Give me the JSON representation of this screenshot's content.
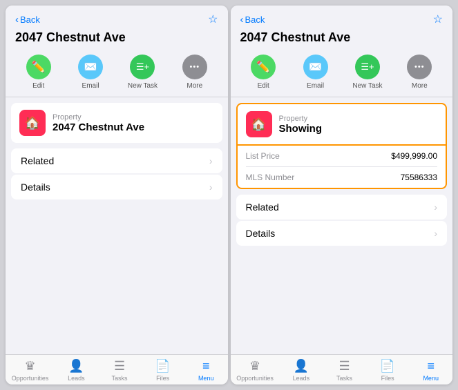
{
  "left_panel": {
    "back_label": "Back",
    "title": "2047 Chestnut Ave",
    "bookmark_icon": "☆",
    "actions": [
      {
        "id": "edit",
        "icon": "✏️",
        "label": "Edit",
        "color": "icon-green"
      },
      {
        "id": "email",
        "icon": "✉️",
        "label": "Email",
        "color": "icon-teal"
      },
      {
        "id": "new-task",
        "icon": "≡+",
        "label": "New Task",
        "color": "icon-green2"
      },
      {
        "id": "more",
        "icon": "•••",
        "label": "More",
        "color": "icon-gray"
      }
    ],
    "card": {
      "type_label": "Property",
      "title": "2047 Chestnut Ave"
    },
    "sections": [
      {
        "label": "Related"
      },
      {
        "label": "Details"
      }
    ],
    "tabs": [
      {
        "id": "opportunities",
        "icon": "♛",
        "label": "Opportunities",
        "active": false
      },
      {
        "id": "leads",
        "icon": "👤",
        "label": "Leads",
        "active": false
      },
      {
        "id": "tasks",
        "icon": "☰",
        "label": "Tasks",
        "active": false
      },
      {
        "id": "files",
        "icon": "📄",
        "label": "Files",
        "active": false
      },
      {
        "id": "menu",
        "icon": "≡",
        "label": "Menu",
        "active": true
      }
    ]
  },
  "right_panel": {
    "back_label": "Back",
    "title": "2047 Chestnut Ave",
    "bookmark_icon": "☆",
    "actions": [
      {
        "id": "edit",
        "icon": "✏️",
        "label": "Edit",
        "color": "icon-green"
      },
      {
        "id": "email",
        "icon": "✉️",
        "label": "Email",
        "color": "icon-teal"
      },
      {
        "id": "new-task",
        "icon": "≡+",
        "label": "New Task",
        "color": "icon-green2"
      },
      {
        "id": "more",
        "icon": "•••",
        "label": "More",
        "color": "icon-gray"
      }
    ],
    "card": {
      "type_label": "Property",
      "title": "Showing"
    },
    "card_details": [
      {
        "label": "List Price",
        "value": "$499,999.00"
      },
      {
        "label": "MLS Number",
        "value": "75586333"
      }
    ],
    "sections": [
      {
        "label": "Related"
      },
      {
        "label": "Details"
      }
    ],
    "tabs": [
      {
        "id": "opportunities",
        "icon": "♛",
        "label": "Opportunities",
        "active": false
      },
      {
        "id": "leads",
        "icon": "👤",
        "label": "Leads",
        "active": false
      },
      {
        "id": "tasks",
        "icon": "☰",
        "label": "Tasks",
        "active": false
      },
      {
        "id": "files",
        "icon": "📄",
        "label": "Files",
        "active": false
      },
      {
        "id": "menu",
        "icon": "≡",
        "label": "Menu",
        "active": true
      }
    ]
  }
}
